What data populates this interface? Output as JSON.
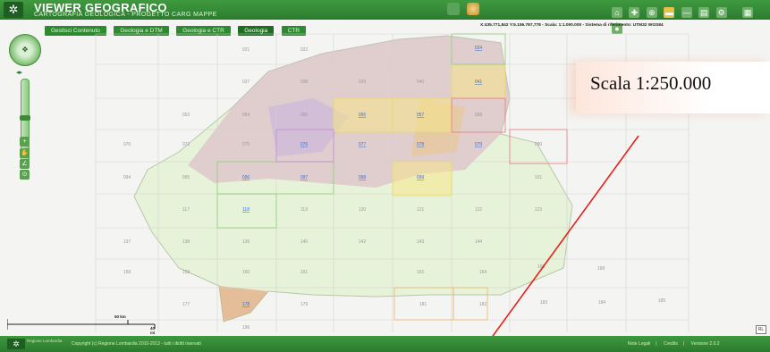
{
  "header": {
    "title": "VIEWER GEOGRAFICO",
    "subtitle": "CARTOGRAFIA GEOLOGICA - PROGETTO CARG MAPPE"
  },
  "tabs": [
    {
      "label": "Gestisci Contenuto",
      "active": false
    },
    {
      "label": "Geologia e DTM",
      "active": false
    },
    {
      "label": "Geologia e CTR",
      "active": false
    },
    {
      "label": "Geologia",
      "active": true
    },
    {
      "label": "CTR",
      "active": false
    }
  ],
  "coordinates": "X:435.771,842 Y:5.156.787,778 - Scala: 1:1.000.000 - Sistema di riferimento: UTM32 WGS84",
  "callout": "Scala 1:250.000",
  "scalebar": {
    "top_label": "50 km",
    "bottom_label": "40 mi"
  },
  "sheets": [
    {
      "label": "021",
      "link": false
    },
    {
      "label": "022",
      "link": false
    },
    {
      "label": "024",
      "link": true
    },
    {
      "label": "037",
      "link": false
    },
    {
      "label": "038",
      "link": false
    },
    {
      "label": "039",
      "link": false
    },
    {
      "label": "040",
      "link": false
    },
    {
      "label": "041",
      "link": true
    },
    {
      "label": "053",
      "link": false
    },
    {
      "label": "054",
      "link": false
    },
    {
      "label": "055",
      "link": false
    },
    {
      "label": "056",
      "link": true
    },
    {
      "label": "057",
      "link": true
    },
    {
      "label": "058",
      "link": false
    },
    {
      "label": "070",
      "link": false
    },
    {
      "label": "071",
      "link": false
    },
    {
      "label": "075",
      "link": false
    },
    {
      "label": "076",
      "link": true
    },
    {
      "label": "077",
      "link": true
    },
    {
      "label": "078",
      "link": true
    },
    {
      "label": "079",
      "link": true
    },
    {
      "label": "080",
      "link": false
    },
    {
      "label": "094",
      "link": false
    },
    {
      "label": "095",
      "link": false
    },
    {
      "label": "096",
      "link": true
    },
    {
      "label": "097",
      "link": true
    },
    {
      "label": "098",
      "link": true
    },
    {
      "label": "099",
      "link": true
    },
    {
      "label": "101",
      "link": false
    },
    {
      "label": "117",
      "link": false
    },
    {
      "label": "118",
      "link": true
    },
    {
      "label": "119",
      "link": false
    },
    {
      "label": "120",
      "link": false
    },
    {
      "label": "121",
      "link": false
    },
    {
      "label": "122",
      "link": false
    },
    {
      "label": "123",
      "link": false
    },
    {
      "label": "137",
      "link": false
    },
    {
      "label": "138",
      "link": false
    },
    {
      "label": "139",
      "link": false
    },
    {
      "label": "140",
      "link": false
    },
    {
      "label": "142",
      "link": false
    },
    {
      "label": "143",
      "link": false
    },
    {
      "label": "144",
      "link": false
    },
    {
      "label": "158",
      "link": false
    },
    {
      "label": "159",
      "link": false
    },
    {
      "label": "160",
      "link": false
    },
    {
      "label": "161",
      "link": false
    },
    {
      "label": "163",
      "link": false
    },
    {
      "label": "164",
      "link": false
    },
    {
      "label": "165",
      "link": false
    },
    {
      "label": "168",
      "link": false
    },
    {
      "label": "177",
      "link": false
    },
    {
      "label": "178",
      "link": true
    },
    {
      "label": "179",
      "link": false
    },
    {
      "label": "181",
      "link": false
    },
    {
      "label": "182",
      "link": false
    },
    {
      "label": "183",
      "link": false
    },
    {
      "label": "184",
      "link": false
    },
    {
      "label": "185",
      "link": false
    },
    {
      "label": "196",
      "link": false
    }
  ],
  "footer": {
    "brand": "Regione Lombardia",
    "copyright": "Copyright (c) Regione Lombardia 2010-2013 - tutti i diritti riservati",
    "links": [
      "Note Legali",
      "Credits",
      "Versione 2.0.2"
    ]
  },
  "colors": {
    "header_green": "#2c7c2f",
    "footer_green": "#2b7a2e",
    "callout_line": "#e8201c"
  }
}
